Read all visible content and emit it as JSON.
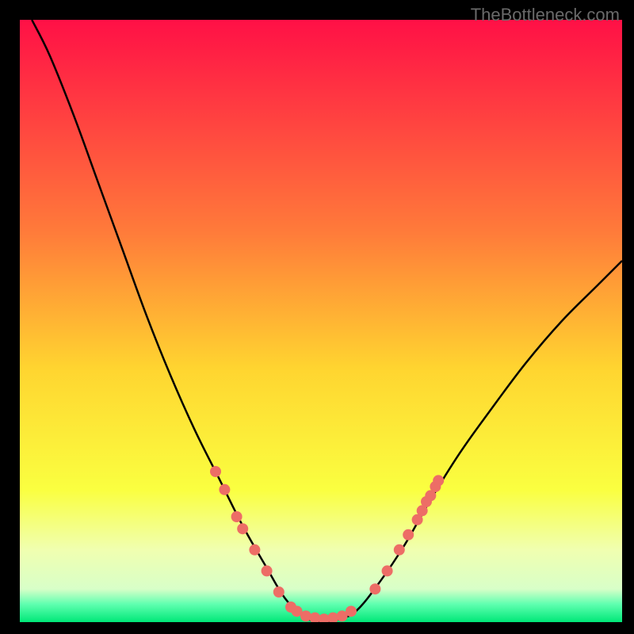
{
  "watermark": "TheBottleneck.com",
  "chart_data": {
    "type": "line",
    "title": "",
    "xlabel": "",
    "ylabel": "",
    "x_range": [
      0,
      100
    ],
    "y_range": [
      0,
      100
    ],
    "gradient_stops": [
      {
        "offset": 0.0,
        "color": "#ff1046"
      },
      {
        "offset": 0.35,
        "color": "#ff7a3a"
      },
      {
        "offset": 0.58,
        "color": "#ffd530"
      },
      {
        "offset": 0.78,
        "color": "#faff40"
      },
      {
        "offset": 0.88,
        "color": "#f0ffb0"
      },
      {
        "offset": 0.945,
        "color": "#d8ffc8"
      },
      {
        "offset": 0.97,
        "color": "#60ffb0"
      },
      {
        "offset": 1.0,
        "color": "#00e878"
      }
    ],
    "curve": [
      {
        "x": 2,
        "y": 100
      },
      {
        "x": 5,
        "y": 94
      },
      {
        "x": 9,
        "y": 84
      },
      {
        "x": 13,
        "y": 73
      },
      {
        "x": 17,
        "y": 62
      },
      {
        "x": 21,
        "y": 51
      },
      {
        "x": 25,
        "y": 41
      },
      {
        "x": 29,
        "y": 32
      },
      {
        "x": 33,
        "y": 24
      },
      {
        "x": 37,
        "y": 16
      },
      {
        "x": 41,
        "y": 9
      },
      {
        "x": 44,
        "y": 4
      },
      {
        "x": 47,
        "y": 1
      },
      {
        "x": 50,
        "y": 0
      },
      {
        "x": 53,
        "y": 0.5
      },
      {
        "x": 56,
        "y": 2
      },
      {
        "x": 60,
        "y": 7
      },
      {
        "x": 64,
        "y": 13
      },
      {
        "x": 68,
        "y": 20
      },
      {
        "x": 73,
        "y": 28
      },
      {
        "x": 78,
        "y": 35
      },
      {
        "x": 84,
        "y": 43
      },
      {
        "x": 90,
        "y": 50
      },
      {
        "x": 96,
        "y": 56
      },
      {
        "x": 100,
        "y": 60
      }
    ],
    "markers": [
      {
        "x": 32.5,
        "y": 25
      },
      {
        "x": 34,
        "y": 22
      },
      {
        "x": 36,
        "y": 17.5
      },
      {
        "x": 37,
        "y": 15.5
      },
      {
        "x": 39,
        "y": 12
      },
      {
        "x": 41,
        "y": 8.5
      },
      {
        "x": 43,
        "y": 5
      },
      {
        "x": 45,
        "y": 2.5
      },
      {
        "x": 46,
        "y": 1.8
      },
      {
        "x": 47.5,
        "y": 1
      },
      {
        "x": 49,
        "y": 0.7
      },
      {
        "x": 50.5,
        "y": 0.5
      },
      {
        "x": 52,
        "y": 0.7
      },
      {
        "x": 53.5,
        "y": 1
      },
      {
        "x": 55,
        "y": 1.8
      },
      {
        "x": 59,
        "y": 5.5
      },
      {
        "x": 61,
        "y": 8.5
      },
      {
        "x": 63,
        "y": 12
      },
      {
        "x": 64.5,
        "y": 14.5
      },
      {
        "x": 66,
        "y": 17
      },
      {
        "x": 66.8,
        "y": 18.5
      },
      {
        "x": 67.5,
        "y": 20
      },
      {
        "x": 68.2,
        "y": 21
      },
      {
        "x": 69,
        "y": 22.5
      },
      {
        "x": 69.5,
        "y": 23.5
      }
    ],
    "marker_color": "#ed6d66",
    "curve_color": "#000000"
  }
}
